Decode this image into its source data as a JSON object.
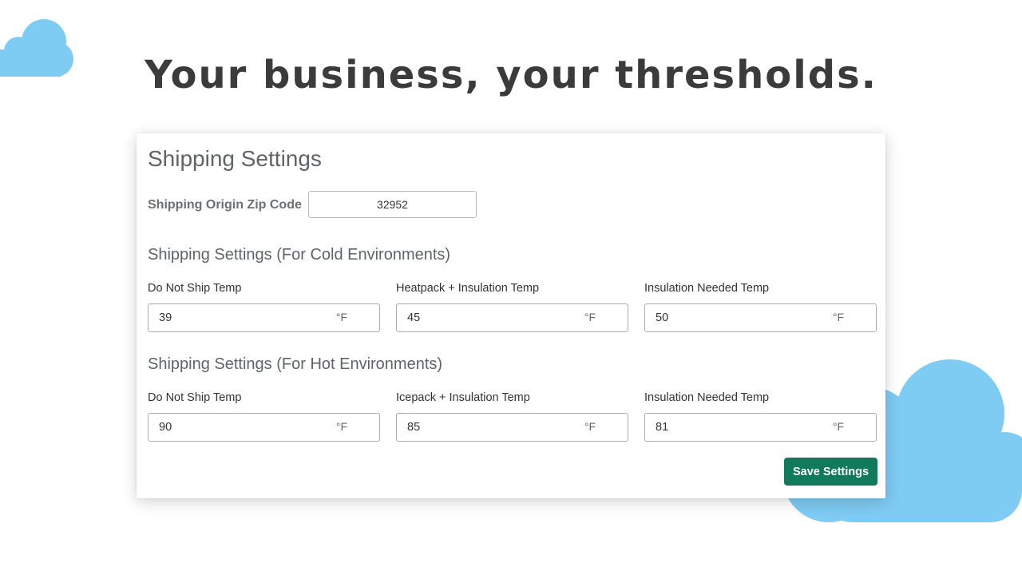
{
  "headline": "Your business, your thresholds.",
  "colors": {
    "cloud": "#7ecbf3",
    "button": "#117a5b",
    "headline": "#3b3b3b"
  },
  "panel": {
    "title": "Shipping Settings",
    "zip": {
      "label": "Shipping Origin Zip Code",
      "value": "32952"
    },
    "cold": {
      "title": "Shipping Settings (For Cold Environments)",
      "fields": [
        {
          "label": "Do Not Ship Temp",
          "value": "39",
          "unit": "°F"
        },
        {
          "label": "Heatpack + Insulation Temp",
          "value": "45",
          "unit": "°F"
        },
        {
          "label": "Insulation Needed Temp",
          "value": "50",
          "unit": "°F"
        }
      ]
    },
    "hot": {
      "title": "Shipping Settings (For Hot Environments)",
      "fields": [
        {
          "label": "Do Not Ship Temp",
          "value": "90",
          "unit": "°F"
        },
        {
          "label": "Icepack + Insulation Temp",
          "value": "85",
          "unit": "°F"
        },
        {
          "label": "Insulation Needed Temp",
          "value": "81",
          "unit": "°F"
        }
      ]
    },
    "save_label": "Save Settings"
  }
}
